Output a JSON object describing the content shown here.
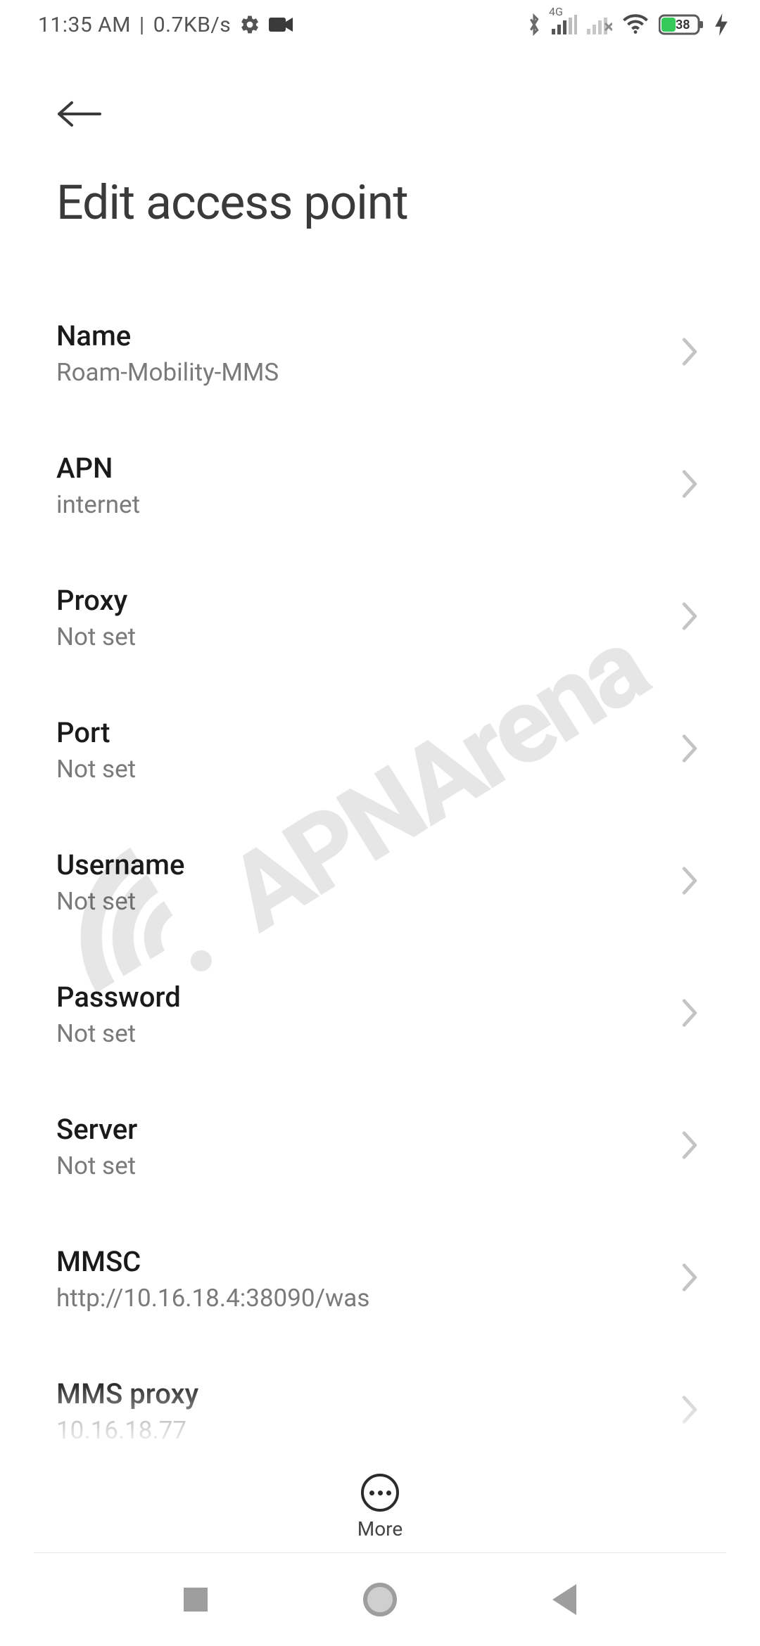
{
  "status": {
    "time": "11:35 AM",
    "sep": "|",
    "net_speed": "0.7KB/s",
    "sim_label": "4G",
    "battery_pct": "38"
  },
  "header": {
    "title": "Edit access point"
  },
  "settings": [
    {
      "label": "Name",
      "value": "Roam-Mobility-MMS"
    },
    {
      "label": "APN",
      "value": "internet"
    },
    {
      "label": "Proxy",
      "value": "Not set"
    },
    {
      "label": "Port",
      "value": "Not set"
    },
    {
      "label": "Username",
      "value": "Not set"
    },
    {
      "label": "Password",
      "value": "Not set"
    },
    {
      "label": "Server",
      "value": "Not set"
    },
    {
      "label": "MMSC",
      "value": "http://10.16.18.4:38090/was"
    },
    {
      "label": "MMS proxy",
      "value": "10.16.18.77"
    }
  ],
  "bottom": {
    "more_label": "More"
  },
  "watermark": {
    "text": "APNArena"
  }
}
